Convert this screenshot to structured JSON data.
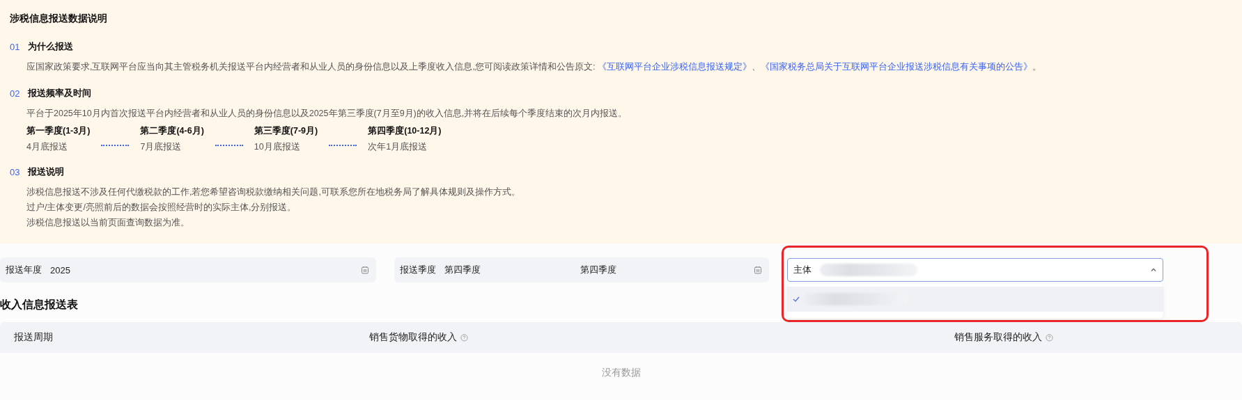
{
  "notice": {
    "title": "涉税信息报送数据说明",
    "sections": [
      {
        "number": "01",
        "heading": "为什么报送",
        "paragraphs": [
          [
            {
              "text": "应国家政策要求,互联网平台应当向其主管税务机关报送平台内经营者和从业人员的身份信息以及上季度收入信息,您可阅读政策详情和公告原文: ",
              "kind": "text"
            },
            {
              "text": "《互联网平台企业涉税信息报送规定》",
              "kind": "link"
            },
            {
              "text": "、",
              "kind": "text"
            },
            {
              "text": "《国家税务总局关于互联网平台企业报送涉税信息有关事项的公告》",
              "kind": "link"
            },
            {
              "text": "。",
              "kind": "text"
            }
          ]
        ]
      },
      {
        "number": "02",
        "heading": "报送频率及时间",
        "paragraphs": [
          [
            {
              "text": "平台于2025年10月内首次报送平台内经营者和从业人员的身份信息以及2025年第三季度(7月至9月)的收入信息,并将在后续每个季度结束的次月内报送。",
              "kind": "text"
            }
          ]
        ],
        "timeline": [
          {
            "quarter": "第一季度(1-3月)",
            "deadline": "4月底报送"
          },
          {
            "quarter": "第二季度(4-6月)",
            "deadline": "7月底报送"
          },
          {
            "quarter": "第三季度(7-9月)",
            "deadline": "10月底报送"
          },
          {
            "quarter": "第四季度(10-12月)",
            "deadline": "次年1月底报送"
          }
        ]
      },
      {
        "number": "03",
        "heading": "报送说明",
        "paragraphs": [
          [
            {
              "text": "涉税信息报送不涉及任何代缴税款的工作,若您希望咨询税款缴纳相关问题,可联系您所在地税务局了解具体规则及操作方式。",
              "kind": "text"
            }
          ],
          [
            {
              "text": "过户/主体变更/亮照前后的数据会按照经营时的实际主体,分别报送。",
              "kind": "text"
            }
          ],
          [
            {
              "text": "涉税信息报送以当前页面查询数据为准。",
              "kind": "text"
            }
          ]
        ]
      }
    ]
  },
  "filters": {
    "year": {
      "label": "报送年度",
      "value": "2025"
    },
    "quarter": {
      "label": "报送季度",
      "start": "第四季度",
      "end": "第四季度"
    },
    "subject": {
      "label": "主体",
      "expanded": true,
      "highlighted": true,
      "options": [
        {
          "selected": true
        }
      ]
    }
  },
  "table": {
    "title": "收入信息报送表",
    "columns": [
      {
        "label": "报送周期",
        "kind": "plain"
      },
      {
        "label": "销售货物取得的收入",
        "kind": "with_help"
      },
      {
        "label": "销售服务取得的收入",
        "kind": "with_help"
      }
    ],
    "empty_text": "没有数据"
  }
}
